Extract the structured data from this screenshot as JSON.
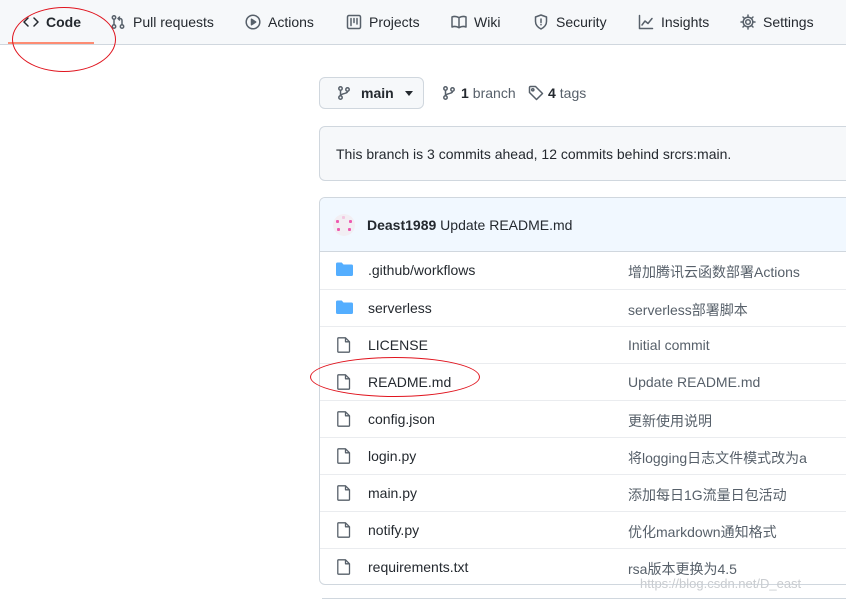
{
  "nav": {
    "tabs": [
      {
        "label": "Code",
        "icon": "code-icon",
        "selected": true
      },
      {
        "label": "Pull requests",
        "icon": "pull-request-icon"
      },
      {
        "label": "Actions",
        "icon": "play-icon"
      },
      {
        "label": "Projects",
        "icon": "project-icon"
      },
      {
        "label": "Wiki",
        "icon": "book-icon"
      },
      {
        "label": "Security",
        "icon": "shield-icon"
      },
      {
        "label": "Insights",
        "icon": "graph-icon"
      },
      {
        "label": "Settings",
        "icon": "gear-icon"
      }
    ]
  },
  "branch_bar": {
    "current_branch": "main",
    "branch_count": "1",
    "branch_label": "branch",
    "tag_count": "4",
    "tag_label": "tags"
  },
  "notice": {
    "text": "This branch is 3 commits ahead, 12 commits behind srcrs:main."
  },
  "latest_commit": {
    "author": "Deast1989",
    "message": "Update README.md"
  },
  "files": [
    {
      "type": "folder",
      "name": ".github/workflows",
      "commit": "增加腾讯云函数部署Actions"
    },
    {
      "type": "folder",
      "name": "serverless",
      "commit": "serverless部署脚本"
    },
    {
      "type": "file",
      "name": "LICENSE",
      "commit": "Initial commit"
    },
    {
      "type": "file",
      "name": "README.md",
      "commit": "Update README.md"
    },
    {
      "type": "file",
      "name": "config.json",
      "commit": "更新使用说明"
    },
    {
      "type": "file",
      "name": "login.py",
      "commit": "将logging日志文件模式改为a"
    },
    {
      "type": "file",
      "name": "main.py",
      "commit": "添加每日1G流量日包活动"
    },
    {
      "type": "file",
      "name": "notify.py",
      "commit": "优化markdown通知格式"
    },
    {
      "type": "file",
      "name": "requirements.txt",
      "commit": "rsa版本更换为4.5"
    }
  ],
  "watermark": "https://blog.csdn.net/D_east",
  "colors": {
    "accent_underline": "#fd8c73",
    "folder": "#54aeff",
    "annotation": "#e0141e",
    "commit_header_bg": "#f1f8ff"
  }
}
